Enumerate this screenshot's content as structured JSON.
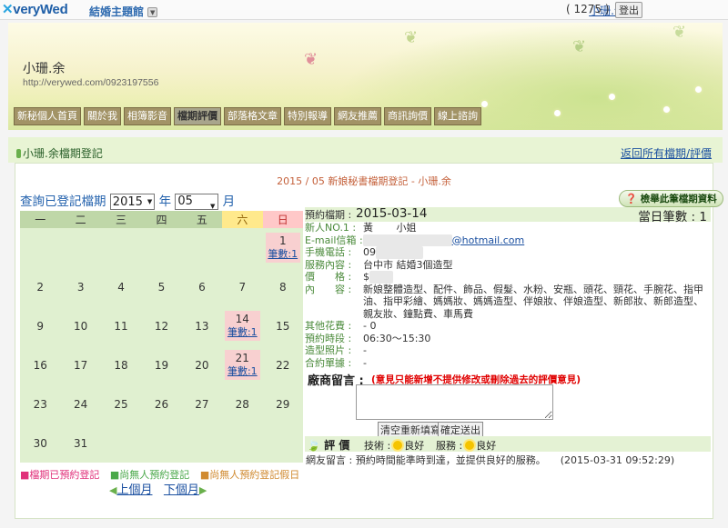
{
  "topbar": {
    "logo": "veryWed",
    "site_menu": "結婚主題館",
    "user_name": "小珊.余",
    "points": "( 1275 )",
    "logout": "登出"
  },
  "banner": {
    "name": "小珊.余",
    "url": "http://verywed.com/0923197556",
    "tabs": [
      "新秘個人首頁",
      "關於我",
      "相簿影音",
      "檔期評價",
      "部落格文章",
      "特別報導",
      "網友推薦",
      "商訊詢價",
      "線上諮詢"
    ],
    "active_tab": "檔期評價"
  },
  "section": {
    "title": "小珊.余檔期登記",
    "back_link": "返回所有檔期/評價"
  },
  "calendar": {
    "month_title": "2015 / 05 新娘秘書檔期登記 - 小珊.余",
    "query_label": "查詢已登記檔期",
    "year": "2015",
    "year_unit": "年",
    "month": "05",
    "month_unit": "月",
    "weekdays": [
      "一",
      "二",
      "三",
      "四",
      "五",
      "六",
      "日"
    ],
    "weeks": [
      [
        {
          "d": ""
        },
        {
          "d": ""
        },
        {
          "d": ""
        },
        {
          "d": ""
        },
        {
          "d": ""
        },
        {
          "d": ""
        },
        {
          "d": "1",
          "booked": "筆數:1"
        }
      ],
      [
        {
          "d": "2"
        },
        {
          "d": "3"
        },
        {
          "d": "4"
        },
        {
          "d": "5"
        },
        {
          "d": "6"
        },
        {
          "d": "7"
        },
        {
          "d": "8"
        }
      ],
      [
        {
          "d": "9"
        },
        {
          "d": "10"
        },
        {
          "d": "11"
        },
        {
          "d": "12"
        },
        {
          "d": "13"
        },
        {
          "d": "14",
          "booked": "筆數:1"
        },
        {
          "d": "15"
        }
      ],
      [
        {
          "d": "16"
        },
        {
          "d": "17"
        },
        {
          "d": "18"
        },
        {
          "d": "19"
        },
        {
          "d": "20"
        },
        {
          "d": "21",
          "booked": "筆數:1"
        },
        {
          "d": "22"
        }
      ],
      [
        {
          "d": "23"
        },
        {
          "d": "24"
        },
        {
          "d": "25"
        },
        {
          "d": "26"
        },
        {
          "d": "27"
        },
        {
          "d": "28"
        },
        {
          "d": "29"
        }
      ],
      [
        {
          "d": "30"
        },
        {
          "d": "31"
        },
        {
          "d": ""
        },
        {
          "d": ""
        },
        {
          "d": ""
        },
        {
          "d": ""
        },
        {
          "d": ""
        }
      ]
    ],
    "legend": [
      "■檔期已預約登記",
      "■尚無人預約登記",
      "■尚無人預約登記假日"
    ],
    "prev": "上個月",
    "next": "下個月"
  },
  "detail": {
    "check_button": "檢舉此筆檔期資料",
    "booking_label": "預約檔期 :",
    "booking_date": "2015-03-14",
    "daily_count": "當日筆數 : 1",
    "rows": [
      {
        "k": "新人NO.1 :",
        "v": "黃　　 小姐"
      },
      {
        "k": "E-mail信箱 :",
        "v": "@hotmail.com"
      },
      {
        "k": "手機電話 :",
        "v": "09"
      },
      {
        "k": "服務內容 :",
        "v": "台中市 結婚3個造型"
      },
      {
        "k": "價　　格 :",
        "v": "$"
      },
      {
        "k": "內　　容 :",
        "v": "新娘整體造型、配件、飾品、假髮、水粉、安瓶、頭花、頸花、手腕花、指甲油、指甲彩繪、媽媽妝、媽媽造型、伴娘妝、伴娘造型、新郎妝、新郎造型、親友妝、鐘點費、車馬費"
      },
      {
        "k": "其他花費 :",
        "v": "- 0"
      },
      {
        "k": "預約時段 :",
        "v": "06:30～15:30"
      },
      {
        "k": "造型照片 :",
        "v": "-"
      },
      {
        "k": "合約單據 :",
        "v": "-"
      }
    ],
    "message_label": "廠商留言 :",
    "message_warning": "(意見只能新增不提供修改或刪除過去的評價意見)",
    "clear_button": "清空重新填寫",
    "submit_button": "確定送出",
    "rating_title": "評 價",
    "tech_label": "技術 :",
    "tech_value": "良好",
    "service_label": "服務 :",
    "service_value": "良好",
    "comment": "網友留言 : 預約時間能準時到達，並提供良好的服務。",
    "comment_time": "(2015-03-31 09:52:29)"
  },
  "colors": {
    "booked": "#f8d0d0",
    "free": "#e0f0d0",
    "holiday": "#ffe98c",
    "warning": "#e00000"
  }
}
